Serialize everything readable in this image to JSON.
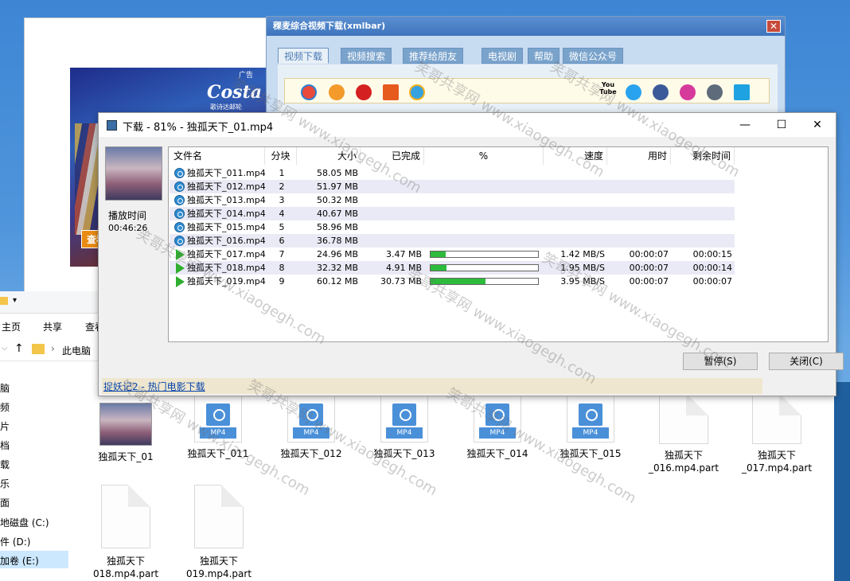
{
  "ad": {
    "tag": "广告",
    "brand": "Costa",
    "subtitle": "歌诗达邮轮",
    "button": "查看详"
  },
  "xmlbar": {
    "title": "稞麦综合视频下载(xmlbar)",
    "tabs": [
      "视频下载",
      "视频搜索",
      "推荐给朋友",
      "电视剧",
      "帮助",
      "微信公众号"
    ],
    "youtube_label": "You Tube"
  },
  "download": {
    "title": "下载 - 81% - 独孤天下_01.mp4",
    "play_label": "播放时间",
    "play_time": "00:46:26",
    "columns": [
      "文件名",
      "分块",
      "大小",
      "已完成",
      "%",
      "速度",
      "用时",
      "剩余时间"
    ],
    "rows": [
      {
        "name": "独孤天下_011.mp4",
        "block": "1",
        "size": "58.05 MB",
        "done": "",
        "percent": "",
        "speed": "",
        "elapsed": "",
        "remaining": ""
      },
      {
        "name": "独孤天下_012.mp4",
        "block": "2",
        "size": "51.97 MB",
        "done": "",
        "percent": "",
        "speed": "",
        "elapsed": "",
        "remaining": ""
      },
      {
        "name": "独孤天下_013.mp4",
        "block": "3",
        "size": "50.32 MB",
        "done": "",
        "percent": "",
        "speed": "",
        "elapsed": "",
        "remaining": ""
      },
      {
        "name": "独孤天下_014.mp4",
        "block": "4",
        "size": "40.67 MB",
        "done": "",
        "percent": "",
        "speed": "",
        "elapsed": "",
        "remaining": ""
      },
      {
        "name": "独孤天下_015.mp4",
        "block": "5",
        "size": "58.96 MB",
        "done": "",
        "percent": "",
        "speed": "",
        "elapsed": "",
        "remaining": ""
      },
      {
        "name": "独孤天下_016.mp4",
        "block": "6",
        "size": "36.78 MB",
        "done": "",
        "percent": "",
        "speed": "",
        "elapsed": "",
        "remaining": ""
      },
      {
        "name": "独孤天下_017.mp4",
        "block": "7",
        "size": "24.96 MB",
        "done": "3.47 MB",
        "percent": 14,
        "speed": "1.42 MB/S",
        "elapsed": "00:00:07",
        "remaining": "00:00:15"
      },
      {
        "name": "独孤天下_018.mp4",
        "block": "8",
        "size": "32.32 MB",
        "done": "4.91 MB",
        "percent": 15,
        "speed": "1.95 MB/S",
        "elapsed": "00:00:07",
        "remaining": "00:00:14"
      },
      {
        "name": "独孤天下_019.mp4",
        "block": "9",
        "size": "60.12 MB",
        "done": "30.73 MB",
        "percent": 51,
        "speed": "3.95 MB/S",
        "elapsed": "00:00:07",
        "remaining": "00:00:07"
      }
    ],
    "pause_button": "暂停(S)",
    "close_button": "关闭(C)",
    "footer_link": "捉妖记2 - 热门电影下载"
  },
  "explorer": {
    "ribbon_tabs": [
      "主页",
      "共享",
      "查看"
    ],
    "breadcrumb": "此电脑",
    "sidebar": [
      "脑",
      "频",
      "片",
      "档",
      "载",
      "乐",
      "面",
      "地磁盘 (C:)",
      "件 (D:)",
      "加卷 (E:)"
    ],
    "files": [
      {
        "name": "独孤天下_01",
        "type": "thumb"
      },
      {
        "name": "独孤天下_011",
        "type": "mp4"
      },
      {
        "name": "独孤天下_012",
        "type": "mp4"
      },
      {
        "name": "独孤天下_013",
        "type": "mp4"
      },
      {
        "name": "独孤天下_014",
        "type": "mp4"
      },
      {
        "name": "独孤天下_015",
        "type": "mp4"
      },
      {
        "name": "独孤天下\n_016.mp4.part",
        "type": "part"
      },
      {
        "name": "独孤天下\n_017.mp4.part",
        "type": "part"
      },
      {
        "name": "独孤天下\n018.mp4.part",
        "type": "part"
      },
      {
        "name": "独孤天下\n019.mp4.part",
        "type": "part"
      }
    ],
    "mp4_badge": "MP4"
  },
  "watermark": "笑哥共享网 www.xiaogegh.com"
}
